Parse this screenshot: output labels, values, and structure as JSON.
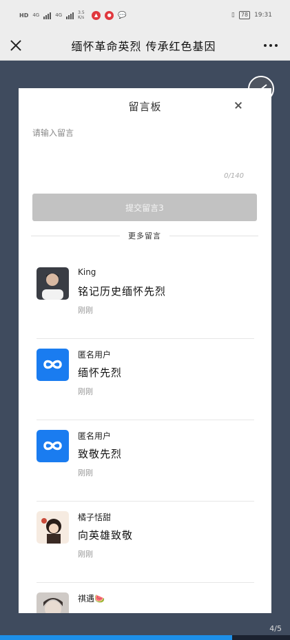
{
  "status_bar": {
    "network_left": "HD",
    "signal1": "4G",
    "signal2": "4G",
    "speed": "3.5 K/s",
    "time": "19:31",
    "battery": "78"
  },
  "nav": {
    "title": "缅怀革命英烈 传承红色基因"
  },
  "modal": {
    "title": "留言板",
    "input_placeholder": "请输入留言",
    "char_count": "0/140",
    "submit_label": "提交留言3",
    "more_label": "更多留言"
  },
  "comments": [
    {
      "name": "King",
      "text": "铭记历史缅怀先烈",
      "time": "刚刚",
      "avatar": "photo-man"
    },
    {
      "name": "匿名用户",
      "text": "缅怀先烈",
      "time": "刚刚",
      "avatar": "infinity-logo"
    },
    {
      "name": "匿名用户",
      "text": "致敬先烈",
      "time": "刚刚",
      "avatar": "infinity-logo"
    },
    {
      "name": "橘子恬甜",
      "text": "向英雄致敬",
      "time": "刚刚",
      "avatar": "cartoon-girl"
    },
    {
      "name": "祺遇🍉",
      "text": "",
      "time": "",
      "avatar": "photo-girl"
    }
  ],
  "pagination": {
    "label": "4/5",
    "progress": 0.8
  },
  "colors": {
    "accent": "#1d8fe8",
    "submit_disabled": "#c2c2c2",
    "backdrop": "#3f4b5e",
    "logo_blue": "#1a7cf0"
  }
}
